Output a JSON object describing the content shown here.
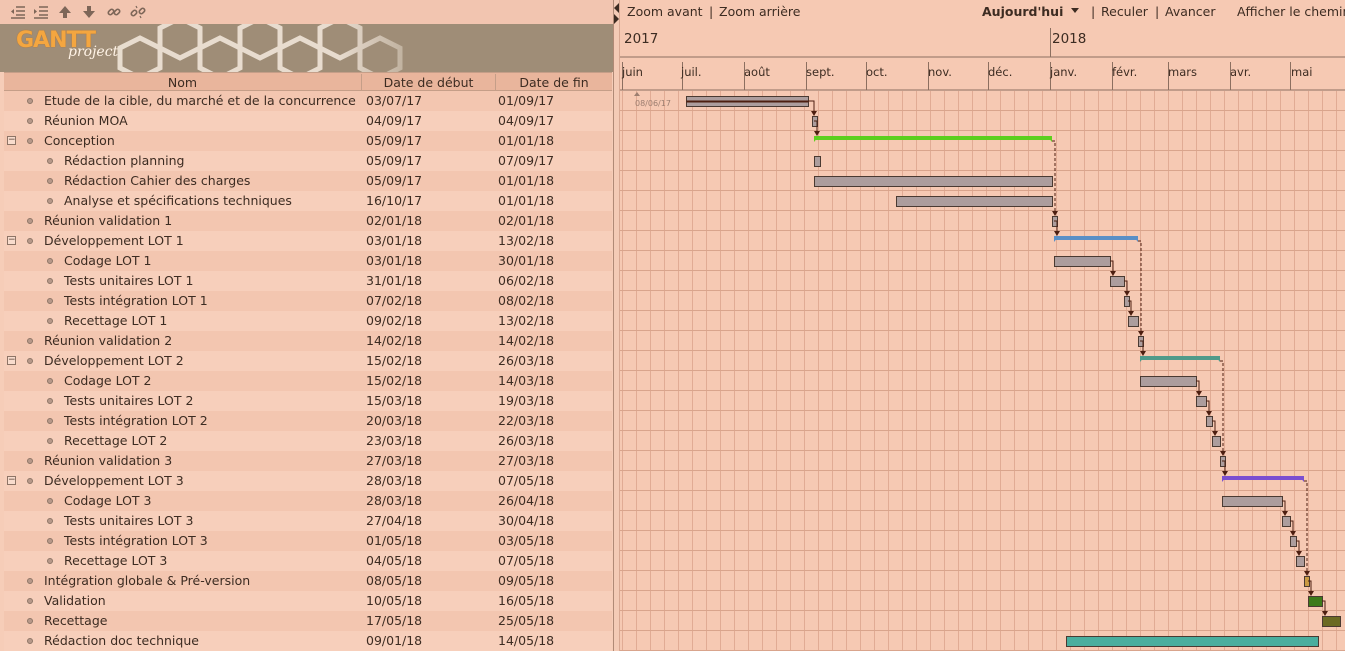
{
  "colors": {
    "panel_bg": "#f6cdb8",
    "row_alt": "#f7cfbb",
    "row_base": "#f3c6b0",
    "chart_bg": "#f6c9b3",
    "grid": "#e1ab94",
    "task_bar": "#ac9d9d",
    "task_bar_border": "#4a3a32",
    "conception_summary": "#5dcf1e",
    "lot1_summary": "#5a8fc6",
    "lot2_summary": "#4f9a8a",
    "lot3_summary": "#7b4fd0",
    "integration_bar": "#c99a43",
    "validation_bar": "#3d7a1a",
    "recettage_bar": "#6b6a23",
    "doc_bar": "#4aae9e",
    "dependency_arrow": "#4d1e10"
  },
  "toolbar": {
    "icons": [
      "unindent-icon",
      "indent-icon",
      "move-up-icon",
      "move-down-icon",
      "link-icon",
      "unlink-icon"
    ]
  },
  "logo": {
    "text": "GANTT",
    "subtext": "project"
  },
  "table": {
    "columns": [
      "Nom",
      "Date de début",
      "Date de fin"
    ],
    "rows": [
      {
        "name": "Etude de la cible, du marché et de la concurrence",
        "start": "03/07/17",
        "end": "01/09/17",
        "level": 0,
        "group": false
      },
      {
        "name": "Réunion MOA",
        "start": "04/09/17",
        "end": "04/09/17",
        "level": 0,
        "group": false
      },
      {
        "name": "Conception",
        "start": "05/09/17",
        "end": "01/01/18",
        "level": 0,
        "group": true
      },
      {
        "name": "Rédaction planning",
        "start": "05/09/17",
        "end": "07/09/17",
        "level": 1,
        "group": false
      },
      {
        "name": "Rédaction Cahier des charges",
        "start": "05/09/17",
        "end": "01/01/18",
        "level": 1,
        "group": false
      },
      {
        "name": "Analyse et spécifications techniques",
        "start": "16/10/17",
        "end": "01/01/18",
        "level": 1,
        "group": false
      },
      {
        "name": "Réunion validation 1",
        "start": "02/01/18",
        "end": "02/01/18",
        "level": 0,
        "group": false
      },
      {
        "name": "Développement LOT 1",
        "start": "03/01/18",
        "end": "13/02/18",
        "level": 0,
        "group": true
      },
      {
        "name": "Codage LOT 1",
        "start": "03/01/18",
        "end": "30/01/18",
        "level": 1,
        "group": false
      },
      {
        "name": "Tests unitaires LOT 1",
        "start": "31/01/18",
        "end": "06/02/18",
        "level": 1,
        "group": false
      },
      {
        "name": "Tests intégration LOT 1",
        "start": "07/02/18",
        "end": "08/02/18",
        "level": 1,
        "group": false
      },
      {
        "name": "Recettage LOT 1",
        "start": "09/02/18",
        "end": "13/02/18",
        "level": 1,
        "group": false
      },
      {
        "name": "Réunion validation 2",
        "start": "14/02/18",
        "end": "14/02/18",
        "level": 0,
        "group": false
      },
      {
        "name": "Développement LOT 2",
        "start": "15/02/18",
        "end": "26/03/18",
        "level": 0,
        "group": true
      },
      {
        "name": "Codage LOT 2",
        "start": "15/02/18",
        "end": "14/03/18",
        "level": 1,
        "group": false
      },
      {
        "name": "Tests unitaires LOT 2",
        "start": "15/03/18",
        "end": "19/03/18",
        "level": 1,
        "group": false
      },
      {
        "name": "Tests intégration LOT 2",
        "start": "20/03/18",
        "end": "22/03/18",
        "level": 1,
        "group": false
      },
      {
        "name": "Recettage LOT 2",
        "start": "23/03/18",
        "end": "26/03/18",
        "level": 1,
        "group": false
      },
      {
        "name": "Réunion validation 3",
        "start": "27/03/18",
        "end": "27/03/18",
        "level": 0,
        "group": false
      },
      {
        "name": "Développement LOT 3",
        "start": "28/03/18",
        "end": "07/05/18",
        "level": 0,
        "group": true
      },
      {
        "name": "Codage LOT 3",
        "start": "28/03/18",
        "end": "26/04/18",
        "level": 1,
        "group": false
      },
      {
        "name": "Tests unitaires LOT 3",
        "start": "27/04/18",
        "end": "30/04/18",
        "level": 1,
        "group": false
      },
      {
        "name": "Tests intégration LOT 3",
        "start": "01/05/18",
        "end": "03/05/18",
        "level": 1,
        "group": false
      },
      {
        "name": "Recettage LOT 3",
        "start": "04/05/18",
        "end": "07/05/18",
        "level": 1,
        "group": false
      },
      {
        "name": "Intégration globale & Pré-version",
        "start": "08/05/18",
        "end": "09/05/18",
        "level": 0,
        "group": false
      },
      {
        "name": "Validation",
        "start": "10/05/18",
        "end": "16/05/18",
        "level": 0,
        "group": false
      },
      {
        "name": "Recettage",
        "start": "17/05/18",
        "end": "25/05/18",
        "level": 0,
        "group": false
      },
      {
        "name": "Rédaction doc technique",
        "start": "09/01/18",
        "end": "14/05/18",
        "level": 0,
        "group": false
      }
    ]
  },
  "chart_toolbar": {
    "zoom_in": "Zoom avant",
    "zoom_out": "Zoom arrière",
    "today": "Aujourd'hui",
    "back": "Reculer",
    "forward": "Avancer",
    "show_path": "Afficher le chemin critique"
  },
  "timeline": {
    "years": [
      "2017",
      "2018"
    ],
    "months": [
      "juin",
      "juil.",
      "août",
      "sept.",
      "oct.",
      "nov.",
      "déc.",
      "janv.",
      "févr.",
      "mars",
      "avr.",
      "mai"
    ],
    "today_marker": "08/06/17"
  }
}
